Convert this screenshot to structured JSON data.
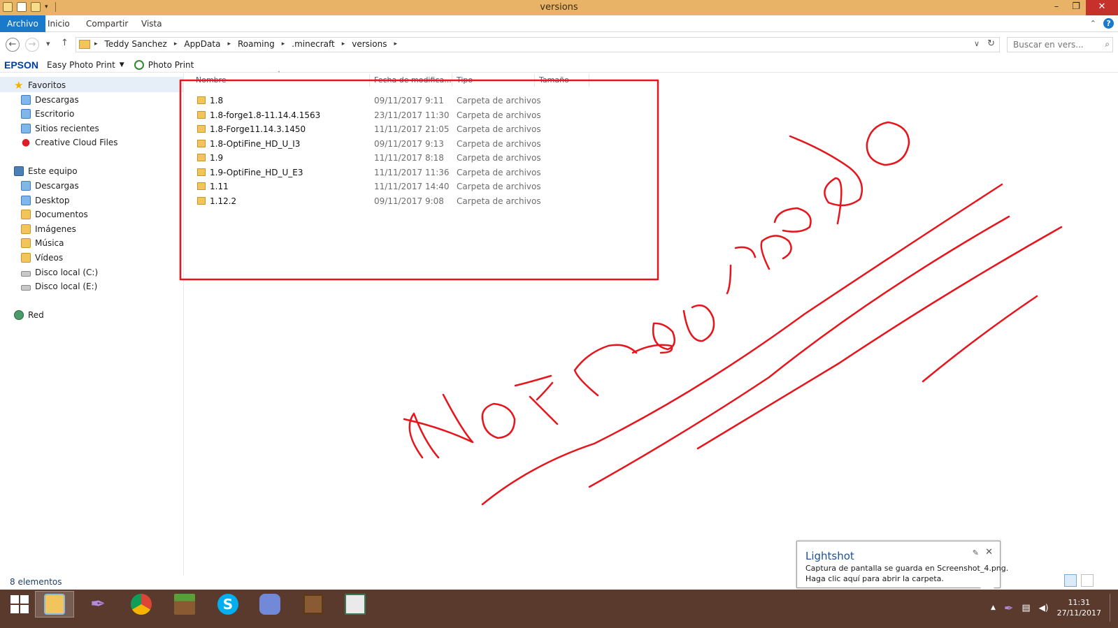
{
  "window": {
    "title": "versions",
    "minimize": "–",
    "maximize": "❐",
    "close": "✕"
  },
  "ribbon": {
    "tabs": [
      "Archivo",
      "Inicio",
      "Compartir",
      "Vista"
    ],
    "collapse": "⌃",
    "help": "?"
  },
  "address": {
    "back": "←",
    "forward": "→",
    "recent": "▾",
    "up": "↑",
    "breadcrumb": [
      "Teddy Sanchez",
      "AppData",
      "Roaming",
      ".minecraft",
      "versions"
    ],
    "sep": "▸",
    "dropdown": "∨",
    "refresh": "↻",
    "search_placeholder": "Buscar en vers...",
    "search_icon": "⌕"
  },
  "toolbar": {
    "brand": "EPSON",
    "easy_photo_print": "Easy Photo Print",
    "caret": "▼",
    "photo_print": "Photo Print"
  },
  "nav": {
    "favorites_label": "Favoritos",
    "favorites": [
      "Descargas",
      "Escritorio",
      "Sitios recientes",
      "Creative Cloud Files"
    ],
    "pc_label": "Este equipo",
    "pc_items": [
      "Descargas",
      "Desktop",
      "Documentos",
      "Imágenes",
      "Música",
      "Vídeos",
      "Disco local (C:)",
      "Disco local (E:)"
    ],
    "network_label": "Red"
  },
  "columns": {
    "name": "Nombre",
    "date": "Fecha de modifica...",
    "type": "Tipo",
    "size": "Tamaño",
    "sort_caret": "˄"
  },
  "files": [
    {
      "name": "1.8",
      "date": "09/11/2017 9:11",
      "type": "Carpeta de archivos"
    },
    {
      "name": "1.8-forge1.8-11.14.4.1563",
      "date": "23/11/2017 11:30",
      "type": "Carpeta de archivos"
    },
    {
      "name": "1.8-Forge11.14.3.1450",
      "date": "11/11/2017 21:05",
      "type": "Carpeta de archivos"
    },
    {
      "name": "1.8-OptiFine_HD_U_I3",
      "date": "09/11/2017 9:13",
      "type": "Carpeta de archivos"
    },
    {
      "name": "1.9",
      "date": "11/11/2017 8:18",
      "type": "Carpeta de archivos"
    },
    {
      "name": "1.9-OptiFine_HD_U_E3",
      "date": "11/11/2017 11:36",
      "type": "Carpeta de archivos"
    },
    {
      "name": "1.11",
      "date": "11/11/2017 14:40",
      "type": "Carpeta de archivos"
    },
    {
      "name": "1.12.2",
      "date": "09/11/2017 9:08",
      "type": "Carpeta de archivos"
    }
  ],
  "status": {
    "count": "8 elementos"
  },
  "annotation": {
    "color": "#e8141c"
  },
  "toast": {
    "title": "Lightshot",
    "line1": "Captura de pantalla se guarda en Screenshot_4.png.",
    "line2": "Haga clic aquí para abrir la carpeta.",
    "pin": "✎",
    "close": "✕"
  },
  "taskbar": {
    "apps": [
      "start",
      "file-explorer",
      "lightshot",
      "chrome",
      "minecraft",
      "skype",
      "discord",
      "crafting-table",
      "monitor"
    ],
    "tray_arrow": "▲",
    "volume": "◀)",
    "time": "11:31",
    "date": "27/11/2017"
  }
}
